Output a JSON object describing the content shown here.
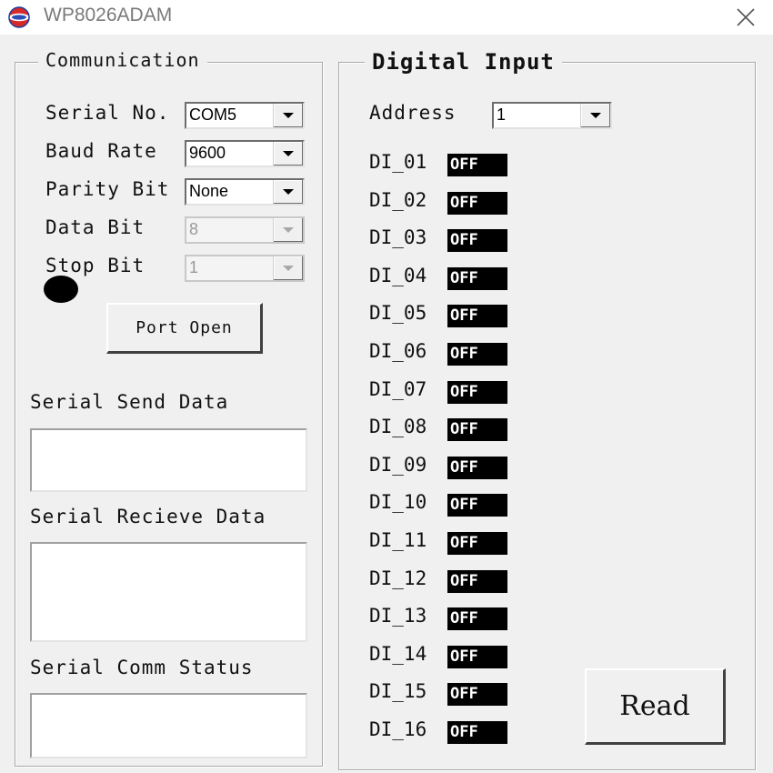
{
  "window": {
    "title": "WP8026ADAM",
    "icon": "app-logo-icon",
    "close_icon": "close-icon"
  },
  "communication": {
    "group_title": "Communication",
    "fields": [
      {
        "label": "Serial No.",
        "value": "COM5",
        "enabled": true
      },
      {
        "label": "Baud Rate",
        "value": "9600",
        "enabled": true
      },
      {
        "label": "Parity Bit",
        "value": "None",
        "enabled": true
      },
      {
        "label": "Data Bit",
        "value": "8",
        "enabled": false
      },
      {
        "label": "Stop Bit",
        "value": "1",
        "enabled": false
      }
    ],
    "port_button": "Port Open",
    "status_led_color": "#000000"
  },
  "serial": {
    "send_label": "Serial Send Data",
    "send_value": "",
    "receive_label": "Serial Recieve Data",
    "receive_value": "",
    "status_label": "Serial Comm Status",
    "status_value": ""
  },
  "digital_input": {
    "group_title": "Digital Input",
    "address_label": "Address",
    "address_value": "1",
    "inputs": [
      {
        "label": "DI_01",
        "state": "OFF"
      },
      {
        "label": "DI_02",
        "state": "OFF"
      },
      {
        "label": "DI_03",
        "state": "OFF"
      },
      {
        "label": "DI_04",
        "state": "OFF"
      },
      {
        "label": "DI_05",
        "state": "OFF"
      },
      {
        "label": "DI_06",
        "state": "OFF"
      },
      {
        "label": "DI_07",
        "state": "OFF"
      },
      {
        "label": "DI_08",
        "state": "OFF"
      },
      {
        "label": "DI_09",
        "state": "OFF"
      },
      {
        "label": "DI_10",
        "state": "OFF"
      },
      {
        "label": "DI_11",
        "state": "OFF"
      },
      {
        "label": "DI_12",
        "state": "OFF"
      },
      {
        "label": "DI_13",
        "state": "OFF"
      },
      {
        "label": "DI_14",
        "state": "OFF"
      },
      {
        "label": "DI_15",
        "state": "OFF"
      },
      {
        "label": "DI_16",
        "state": "OFF"
      }
    ],
    "read_button": "Read",
    "state_bg_color": "#000000",
    "state_text_color": "#ffffff"
  }
}
